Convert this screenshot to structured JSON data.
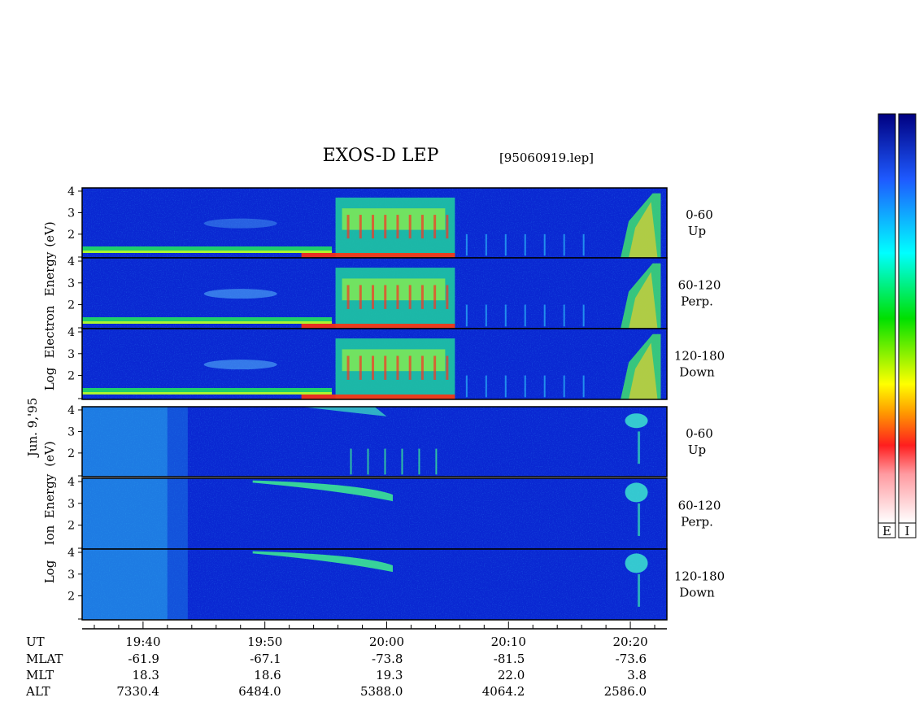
{
  "chart_data": {
    "type": "heatmap",
    "title": "EXOS-D LEP",
    "filename": "[95060919.lep]",
    "date_label": "Jun. 9,'95",
    "x_axis": {
      "ticks": [
        "19:40",
        "19:50",
        "20:00",
        "20:10",
        "20:20"
      ],
      "range": [
        "19:35",
        "20:23"
      ]
    },
    "ephemeris": {
      "rows": [
        {
          "name": "UT",
          "values": [
            "19:40",
            "19:50",
            "20:00",
            "20:10",
            "20:20"
          ]
        },
        {
          "name": "MLAT",
          "values": [
            "-61.9",
            "-67.1",
            "-73.8",
            "-81.5",
            "-73.6"
          ]
        },
        {
          "name": "MLT",
          "values": [
            "18.3",
            "18.6",
            "19.3",
            "22.0",
            "3.8"
          ]
        },
        {
          "name": "ALT",
          "values": [
            "7330.4",
            "6484.0",
            "5388.0",
            "4064.2",
            "2586.0"
          ]
        }
      ]
    },
    "groups": [
      {
        "species": "Electron",
        "ylabel_parts": [
          "Log",
          "Electron",
          "Energy",
          "(eV)"
        ],
        "panels": [
          {
            "angle": "0-60",
            "direction": "Up",
            "y_ticks": [
              "2",
              "3",
              "4"
            ]
          },
          {
            "angle": "60-120",
            "direction": "Perp.",
            "y_ticks": [
              "2",
              "3",
              "4"
            ]
          },
          {
            "angle": "120-180",
            "direction": "Down",
            "y_ticks": [
              "2",
              "3",
              "4"
            ]
          }
        ]
      },
      {
        "species": "Ion",
        "ylabel_parts": [
          "Log",
          "Ion",
          "Energy",
          "(eV)"
        ],
        "panels": [
          {
            "angle": "0-60",
            "direction": "Up",
            "y_ticks": [
              "2",
              "3",
              "4"
            ]
          },
          {
            "angle": "60-120",
            "direction": "Perp.",
            "y_ticks": [
              "2",
              "3",
              "4"
            ]
          },
          {
            "angle": "120-180",
            "direction": "Down",
            "y_ticks": [
              "2",
              "3",
              "4"
            ]
          }
        ]
      }
    ],
    "y_range": [
      1,
      4
    ],
    "colorbars": [
      {
        "label": "E",
        "colors": [
          "#ffffff",
          "#ff2020",
          "#ffa000",
          "#ffff00",
          "#00e000",
          "#00ffff",
          "#0064ff",
          "#000080"
        ]
      },
      {
        "label": "I",
        "colors": [
          "#ffffff",
          "#ff2020",
          "#ffa000",
          "#ffff00",
          "#00e000",
          "#00ffff",
          "#0064ff",
          "#000080"
        ]
      }
    ],
    "background_color": "#0a28d2"
  }
}
